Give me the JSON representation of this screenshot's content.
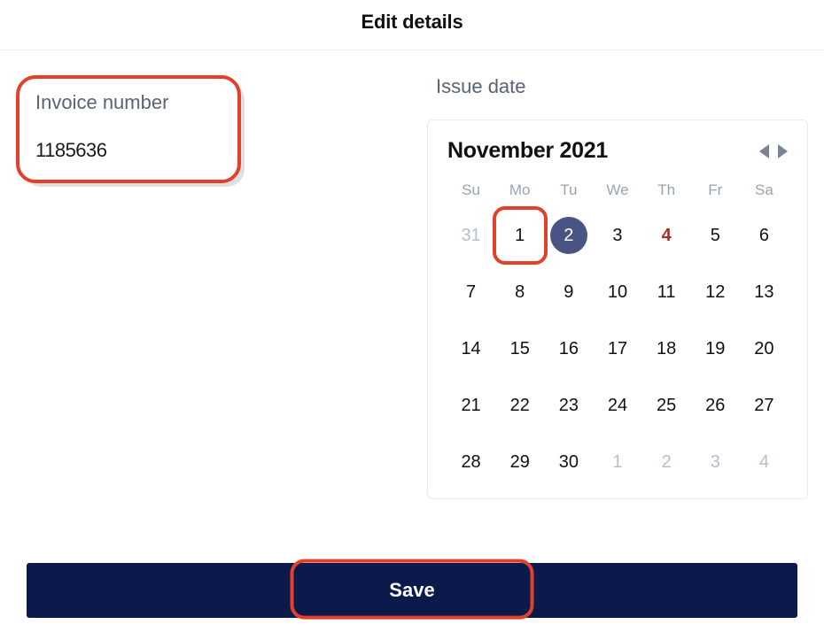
{
  "header": {
    "title": "Edit details"
  },
  "invoice": {
    "label": "Invoice number",
    "value": "1185636"
  },
  "issueDate": {
    "label": "Issue date",
    "monthTitle": "November 2021",
    "weekdays": [
      "Su",
      "Mo",
      "Tu",
      "We",
      "Th",
      "Fr",
      "Sa"
    ],
    "days": [
      {
        "n": "31",
        "other": true
      },
      {
        "n": "1",
        "boxed": true
      },
      {
        "n": "2",
        "selected": true
      },
      {
        "n": "3"
      },
      {
        "n": "4",
        "highlight": true
      },
      {
        "n": "5"
      },
      {
        "n": "6"
      },
      {
        "n": "7"
      },
      {
        "n": "8"
      },
      {
        "n": "9"
      },
      {
        "n": "10"
      },
      {
        "n": "11"
      },
      {
        "n": "12"
      },
      {
        "n": "13"
      },
      {
        "n": "14"
      },
      {
        "n": "15"
      },
      {
        "n": "16"
      },
      {
        "n": "17"
      },
      {
        "n": "18"
      },
      {
        "n": "19"
      },
      {
        "n": "20"
      },
      {
        "n": "21"
      },
      {
        "n": "22"
      },
      {
        "n": "23"
      },
      {
        "n": "24"
      },
      {
        "n": "25"
      },
      {
        "n": "26"
      },
      {
        "n": "27"
      },
      {
        "n": "28"
      },
      {
        "n": "29"
      },
      {
        "n": "30"
      },
      {
        "n": "1",
        "other": true
      },
      {
        "n": "2",
        "other": true
      },
      {
        "n": "3",
        "other": true
      },
      {
        "n": "4",
        "other": true
      }
    ]
  },
  "actions": {
    "saveLabel": "Save"
  },
  "annotations": {
    "highlightColor": "#e2402a",
    "primaryColor": "#0b1a4a",
    "selectedDayBg": "#4a5484"
  }
}
